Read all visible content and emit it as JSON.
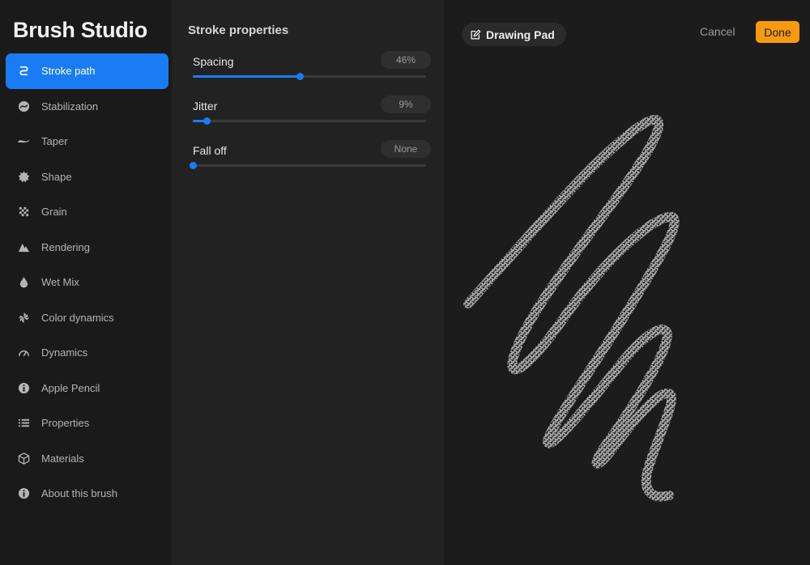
{
  "app": {
    "title": "Brush Studio"
  },
  "sidebar": {
    "items": [
      {
        "label": "Stroke path",
        "icon": "stroke-path-icon",
        "active": true
      },
      {
        "label": "Stabilization",
        "icon": "stabilization-icon",
        "active": false
      },
      {
        "label": "Taper",
        "icon": "taper-icon",
        "active": false
      },
      {
        "label": "Shape",
        "icon": "shape-icon",
        "active": false
      },
      {
        "label": "Grain",
        "icon": "grain-icon",
        "active": false
      },
      {
        "label": "Rendering",
        "icon": "rendering-icon",
        "active": false
      },
      {
        "label": "Wet Mix",
        "icon": "wet-mix-icon",
        "active": false
      },
      {
        "label": "Color dynamics",
        "icon": "color-dynamics-icon",
        "active": false
      },
      {
        "label": "Dynamics",
        "icon": "dynamics-icon",
        "active": false
      },
      {
        "label": "Apple Pencil",
        "icon": "apple-pencil-icon",
        "active": false
      },
      {
        "label": "Properties",
        "icon": "properties-icon",
        "active": false
      },
      {
        "label": "Materials",
        "icon": "materials-icon",
        "active": false
      },
      {
        "label": "About this brush",
        "icon": "about-icon",
        "active": false
      }
    ]
  },
  "panel": {
    "title": "Stroke properties",
    "properties": [
      {
        "label": "Spacing",
        "value": "46%",
        "level": 0.46
      },
      {
        "label": "Jitter",
        "value": "9%",
        "level": 0.06
      },
      {
        "label": "Fall off",
        "value": "None",
        "level": 0.0
      }
    ]
  },
  "pad": {
    "title": "Drawing Pad",
    "cancel_label": "Cancel",
    "done_label": "Done"
  },
  "colors": {
    "accent": "#1a7cf5",
    "done": "#f79a0f",
    "background": "#1a1a1a"
  }
}
